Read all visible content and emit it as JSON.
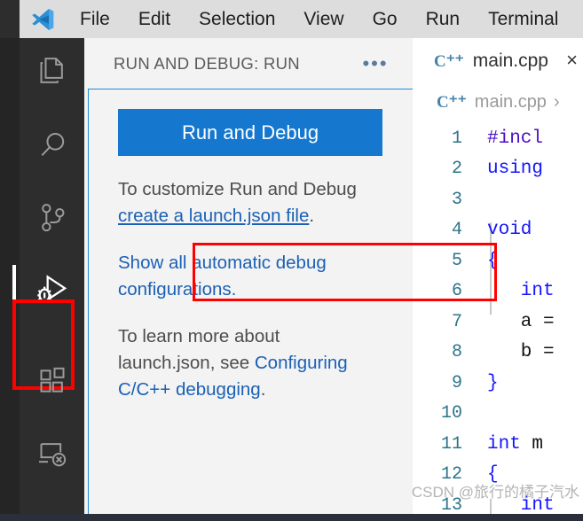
{
  "menubar": {
    "logo_icon": "vscode-logo-icon",
    "items": [
      {
        "label": "File"
      },
      {
        "label": "Edit"
      },
      {
        "label": "Selection"
      },
      {
        "label": "View"
      },
      {
        "label": "Go"
      },
      {
        "label": "Run"
      },
      {
        "label": "Terminal"
      }
    ]
  },
  "activitybar": {
    "items": [
      {
        "name": "explorer",
        "icon": "files-icon"
      },
      {
        "name": "search",
        "icon": "search-icon"
      },
      {
        "name": "source-control",
        "icon": "source-control-icon"
      },
      {
        "name": "run-and-debug",
        "icon": "run-and-debug-icon",
        "active": true,
        "highlighted": true
      },
      {
        "name": "extensions",
        "icon": "extensions-icon"
      },
      {
        "name": "remote-explorer",
        "icon": "remote-explorer-icon"
      }
    ],
    "highlight_color": "#ff0000",
    "active_indicator_color": "#ffffff"
  },
  "sidepanel": {
    "title": "RUN AND DEBUG: RUN",
    "more_actions_icon": "ellipsis-icon",
    "more_actions_label": "•••",
    "run_debug_button": {
      "label": "Run and Debug",
      "color": "#1578ce"
    },
    "customize": {
      "prefix": "To customize Run and Debug ",
      "link": "create a launch.json file",
      "suffix": "."
    },
    "show_all": {
      "link": "Show all automatic debug configurations."
    },
    "learn_more": {
      "prefix": "To learn more about launch.json, see ",
      "link": "Configuring C/C++ debugging",
      "suffix": "."
    },
    "highlight_color": "#ff0000",
    "focus_border_color": "#1e8ad6",
    "link_color": "#1b60b5"
  },
  "editor": {
    "tab": {
      "icon": "cpp-file-icon",
      "icon_glyph": "C⁺⁺",
      "filename": "main.cpp",
      "close_icon": "close-icon",
      "close_glyph": "×"
    },
    "breadcrumb": {
      "icon": "cpp-file-icon",
      "icon_glyph": "C⁺⁺",
      "name": "main.cpp",
      "separator": "›"
    },
    "code_lines": [
      {
        "no": "1",
        "text": "#incl",
        "kind": "pp"
      },
      {
        "no": "2",
        "text": "using",
        "kind": "kw"
      },
      {
        "no": "3",
        "text": "",
        "kind": "plain"
      },
      {
        "no": "4",
        "text": "void",
        "kind": "kw"
      },
      {
        "no": "5",
        "text": "{",
        "kind": "punc"
      },
      {
        "no": "6",
        "text": "   int",
        "kind": "kw"
      },
      {
        "no": "7",
        "text": "   a =",
        "kind": "plain"
      },
      {
        "no": "8",
        "text": "   b =",
        "kind": "plain"
      },
      {
        "no": "9",
        "text": "}",
        "kind": "punc"
      },
      {
        "no": "10",
        "text": "",
        "kind": "plain"
      },
      {
        "no": "11",
        "text": "int m",
        "kind": "kw"
      },
      {
        "no": "12",
        "text": "{",
        "kind": "punc"
      },
      {
        "no": "13",
        "text": "   int",
        "kind": "kw"
      }
    ]
  },
  "watermark": {
    "text": "CSDN @旅行的橘子汽水"
  }
}
